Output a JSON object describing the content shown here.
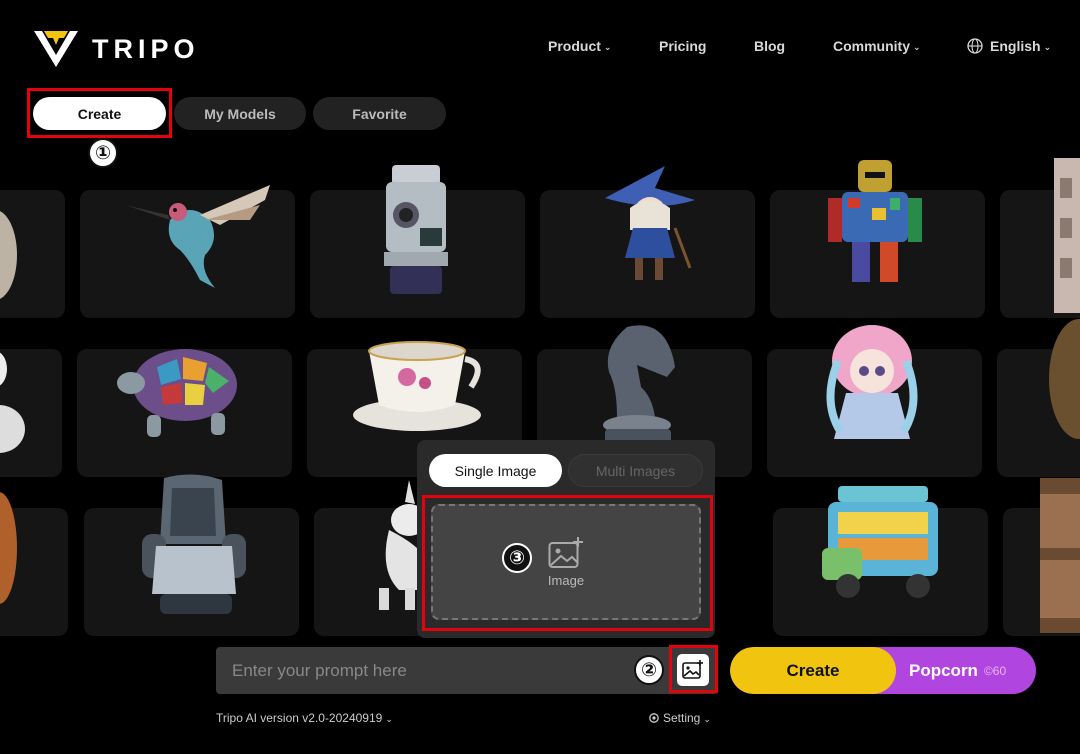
{
  "brand": {
    "name": "TRIPO"
  },
  "nav": {
    "product": "Product",
    "pricing": "Pricing",
    "blog": "Blog",
    "community": "Community",
    "language": "English"
  },
  "tabs": {
    "create": "Create",
    "my_models": "My Models",
    "favorite": "Favorite"
  },
  "annotations": {
    "one": "①",
    "two": "②",
    "three": "③"
  },
  "upload": {
    "single": "Single Image",
    "multi": "Multi Images",
    "dropzone_label": "Image"
  },
  "prompt": {
    "placeholder": "Enter your prompt here"
  },
  "generate": {
    "create": "Create",
    "popcorn": "Popcorn",
    "cost": "60"
  },
  "footer": {
    "version": "Tripo AI version v2.0-20240919",
    "setting": "Setting"
  },
  "colors": {
    "accent_yellow": "#f1c40f",
    "accent_purple": "#b145e0",
    "highlight_red": "#e3030b"
  },
  "gallery": {
    "items": [
      "hummingbird",
      "surveying-instrument",
      "witch-girl",
      "mosaic-knight",
      "turtle",
      "teacup",
      "chess-knight",
      "anime-girl",
      "gaming-chair",
      "unicorn",
      "food-truck",
      "wooden-crate"
    ]
  }
}
